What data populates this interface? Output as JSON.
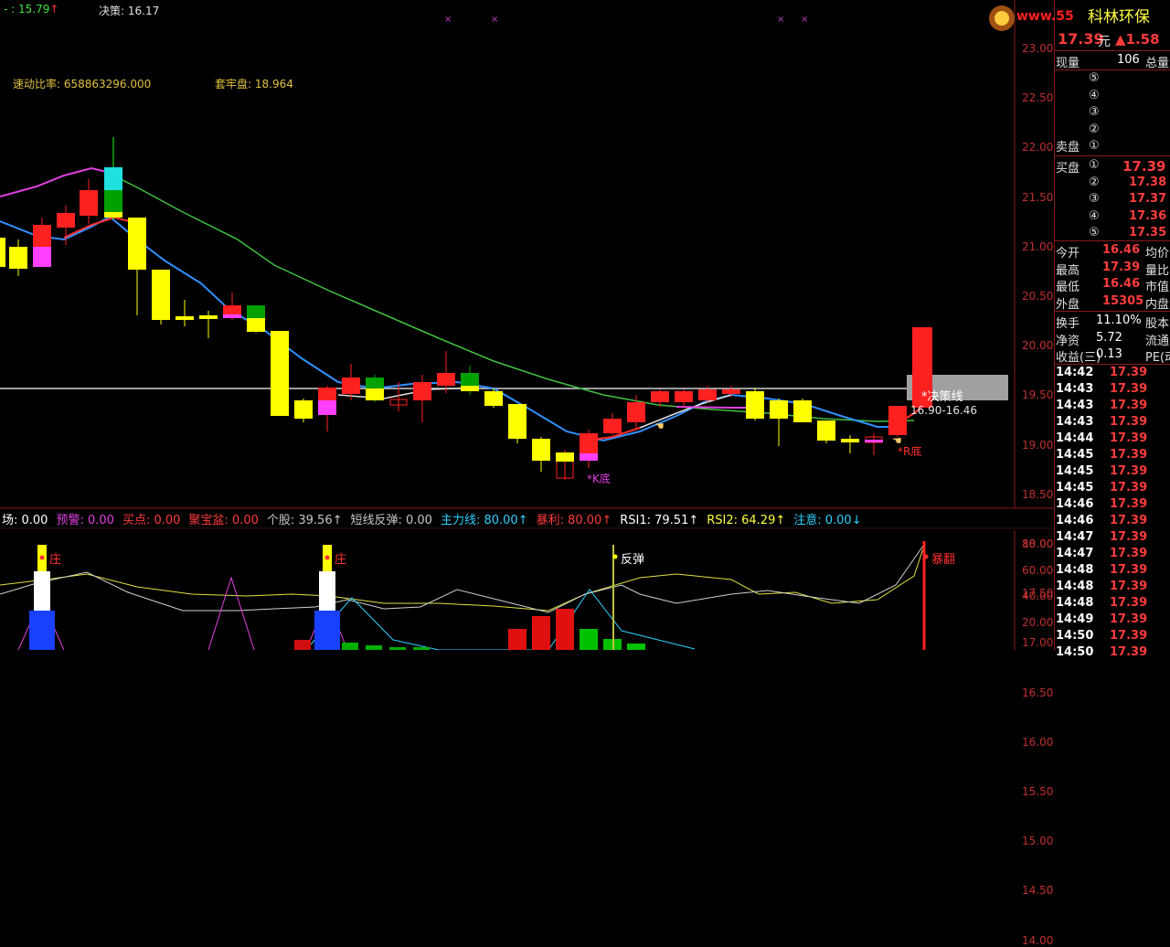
{
  "top_bar": {
    "left_label": "- : 15.79",
    "left_arrow": "↑",
    "decision_label": "决策: 16.17"
  },
  "indicators_main": {
    "quick_ratio": "速动比率:  658863296.000",
    "trapped": "套牢盘:  18.964"
  },
  "chart_labels": {
    "decision_line": "*决策线",
    "range": "16.90-16.46",
    "k_bottom": "*K底",
    "r_bottom": "*R底"
  },
  "price_axis": [
    "23.00",
    "22.50",
    "22.00",
    "21.50",
    "21.00",
    "20.50",
    "20.00",
    "19.50",
    "19.00",
    "18.50",
    "18.00",
    "17.50",
    "17.00",
    "16.50",
    "16.00",
    "15.50",
    "15.00",
    "14.50",
    "14.00"
  ],
  "sub_header": [
    {
      "text": "场: 0.00",
      "color": "#ffffff"
    },
    {
      "text": "预警: 0.00",
      "color": "#e040e0"
    },
    {
      "text": "买点: 0.00",
      "color": "#ff3c3c"
    },
    {
      "text": "聚宝盆: 0.00",
      "color": "#ff3c3c"
    },
    {
      "text": "个股: 39.56↑",
      "color": "#c8c8c8"
    },
    {
      "text": "短线反弹: 0.00",
      "color": "#c8c8c8"
    },
    {
      "text": "主力线: 80.00↑",
      "color": "#30d0ff"
    },
    {
      "text": "暴利: 80.00↑",
      "color": "#ff3c3c"
    },
    {
      "text": "RSI1: 79.51↑",
      "color": "#ffffff"
    },
    {
      "text": "RSI2: 64.29↑",
      "color": "#ffff40"
    },
    {
      "text": "注意: 0.00↓",
      "color": "#30d0ff"
    }
  ],
  "sub_labels": {
    "zhuang1": "庄",
    "zhuang2": "庄",
    "rebound": "反弹",
    "surge": "暴翻"
  },
  "sub_axis": [
    "80.00",
    "60.00",
    "40.00",
    "20.00"
  ],
  "panel": {
    "logo": "科林环保",
    "watermark": "www.55",
    "price": "17.39",
    "price_unit": "元",
    "change": "▲1.58",
    "now_vol_label": "现量",
    "now_vol": "106",
    "total_label": "总量",
    "sell_title": "卖盘",
    "buy_title": "买盘",
    "sell_levels": [
      "⑤",
      "④",
      "③",
      "②",
      "①"
    ],
    "buy_levels": [
      {
        "n": "①",
        "p": "17.39"
      },
      {
        "n": "②",
        "p": "17.38"
      },
      {
        "n": "③",
        "p": "17.37"
      },
      {
        "n": "④",
        "p": "17.36"
      },
      {
        "n": "⑤",
        "p": "17.35"
      }
    ],
    "stats": [
      {
        "l": "今开",
        "v": "16.46",
        "r": "均价"
      },
      {
        "l": "最高",
        "v": "17.39",
        "r": "量比"
      },
      {
        "l": "最低",
        "v": "16.46",
        "r": "市值"
      },
      {
        "l": "外盘",
        "v": "15305",
        "r": "内盘"
      }
    ],
    "stats2": [
      {
        "l": "换手",
        "v": "11.10%",
        "r": "股本"
      },
      {
        "l": "净资",
        "v": "5.72",
        "r": "流通"
      },
      {
        "l": "收益(三)",
        "v": "0.13",
        "r": "PE(动"
      }
    ],
    "ticks": [
      {
        "t": "14:42",
        "p": "17.39"
      },
      {
        "t": "14:43",
        "p": "17.39"
      },
      {
        "t": "14:43",
        "p": "17.39"
      },
      {
        "t": "14:43",
        "p": "17.39"
      },
      {
        "t": "14:44",
        "p": "17.39"
      },
      {
        "t": "14:45",
        "p": "17.39"
      },
      {
        "t": "14:45",
        "p": "17.39"
      },
      {
        "t": "14:45",
        "p": "17.39"
      },
      {
        "t": "14:46",
        "p": "17.39"
      },
      {
        "t": "14:46",
        "p": "17.39"
      },
      {
        "t": "14:47",
        "p": "17.39"
      },
      {
        "t": "14:47",
        "p": "17.39"
      },
      {
        "t": "14:48",
        "p": "17.39"
      },
      {
        "t": "14:48",
        "p": "17.39"
      },
      {
        "t": "14:48",
        "p": "17.39"
      },
      {
        "t": "14:49",
        "p": "17.39"
      },
      {
        "t": "14:50",
        "p": "17.39"
      },
      {
        "t": "14:50",
        "p": "17.39"
      }
    ]
  }
}
